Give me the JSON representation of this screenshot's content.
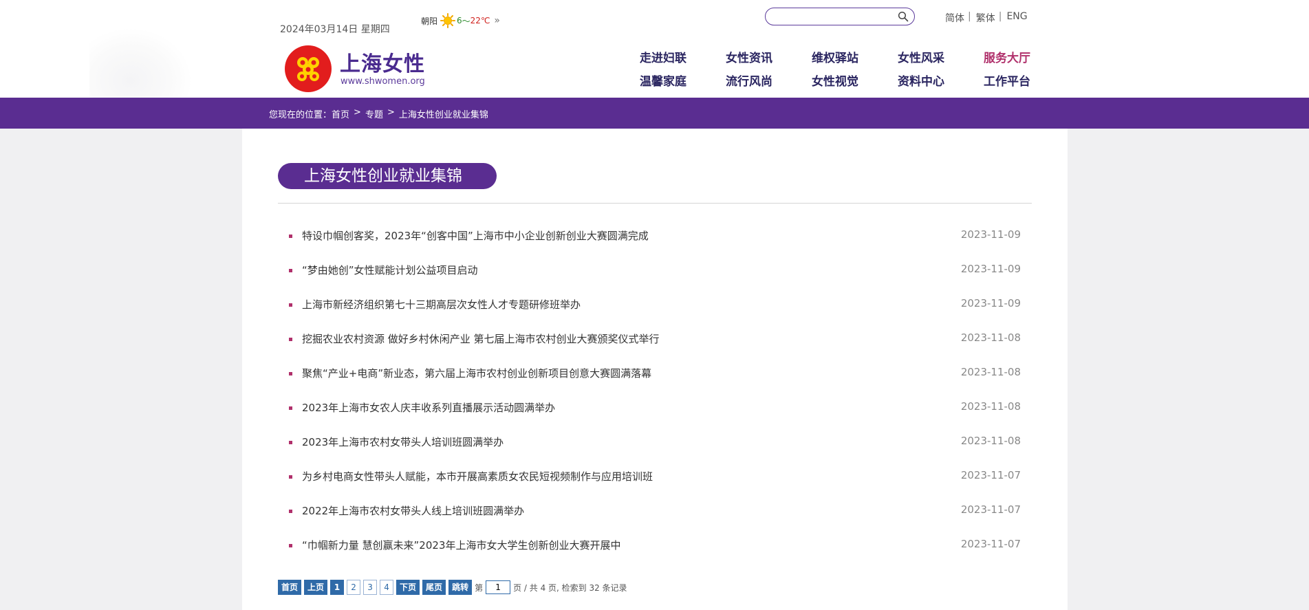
{
  "header": {
    "date": "2024年03月14日 星期四",
    "weather": {
      "city": "朝阳",
      "low": "6",
      "tilde": "～",
      "high": "22℃",
      "more": "»"
    },
    "search": {
      "placeholder": "",
      "value": ""
    },
    "languages": [
      "简体",
      "繁体",
      "ENG"
    ],
    "lang_separator": "|",
    "brand": {
      "name": "上海女性",
      "url": "www.shwomen.org"
    },
    "nav": {
      "row1": [
        "走进妇联",
        "女性资讯",
        "维权驿站",
        "女性风采",
        "服务大厅"
      ],
      "row2": [
        "温馨家庭",
        "流行风尚",
        "女性视觉",
        "资料中心",
        "工作平台"
      ]
    },
    "colors": {
      "brand_purple": "#5a2d91",
      "accent_magenta": "#b0306b",
      "pager_blue": "#2f6aa8"
    }
  },
  "breadcrumb": {
    "prefix": "您现在的位置：",
    "items": [
      "首页",
      "专题",
      "上海女性创业就业集锦"
    ],
    "separator": ">"
  },
  "section_title": "上海女性创业就业集锦",
  "news": [
    {
      "title": "特设巾帼创客奖，2023年“创客中国”上海市中小企业创新创业大赛圆满完成",
      "date": "2023-11-09"
    },
    {
      "title": "“梦由她创”女性赋能计划公益项目启动",
      "date": "2023-11-09"
    },
    {
      "title": "上海市新经济组织第七十三期高层次女性人才专题研修班举办",
      "date": "2023-11-09"
    },
    {
      "title": "挖掘农业农村资源 做好乡村休闲产业 第七届上海市农村创业大赛颁奖仪式举行",
      "date": "2023-11-08"
    },
    {
      "title": "聚焦“产业+电商”新业态，第六届上海市农村创业创新项目创意大赛圆满落幕",
      "date": "2023-11-08"
    },
    {
      "title": "2023年上海市女农人庆丰收系列直播展示活动圆满举办",
      "date": "2023-11-08"
    },
    {
      "title": "2023年上海市农村女带头人培训班圆满举办",
      "date": "2023-11-08"
    },
    {
      "title": "为乡村电商女性带头人赋能，本市开展高素质女农民短视频制作与应用培训班",
      "date": "2023-11-07"
    },
    {
      "title": "2022年上海市农村女带头人线上培训班圆满举办",
      "date": "2023-11-07"
    },
    {
      "title": "“巾帼新力量 慧创赢未来”2023年上海市女大学生创新创业大赛开展中",
      "date": "2023-11-07"
    }
  ],
  "pager": {
    "first": "首页",
    "prev": "上页",
    "pages": [
      "1",
      "2",
      "3",
      "4"
    ],
    "current": "1",
    "next": "下页",
    "last": "尾页",
    "jump": "跳转",
    "page_label": "第",
    "input_value": "1",
    "summary": "页 / 共 4 页, 检索到 32 条记录"
  }
}
